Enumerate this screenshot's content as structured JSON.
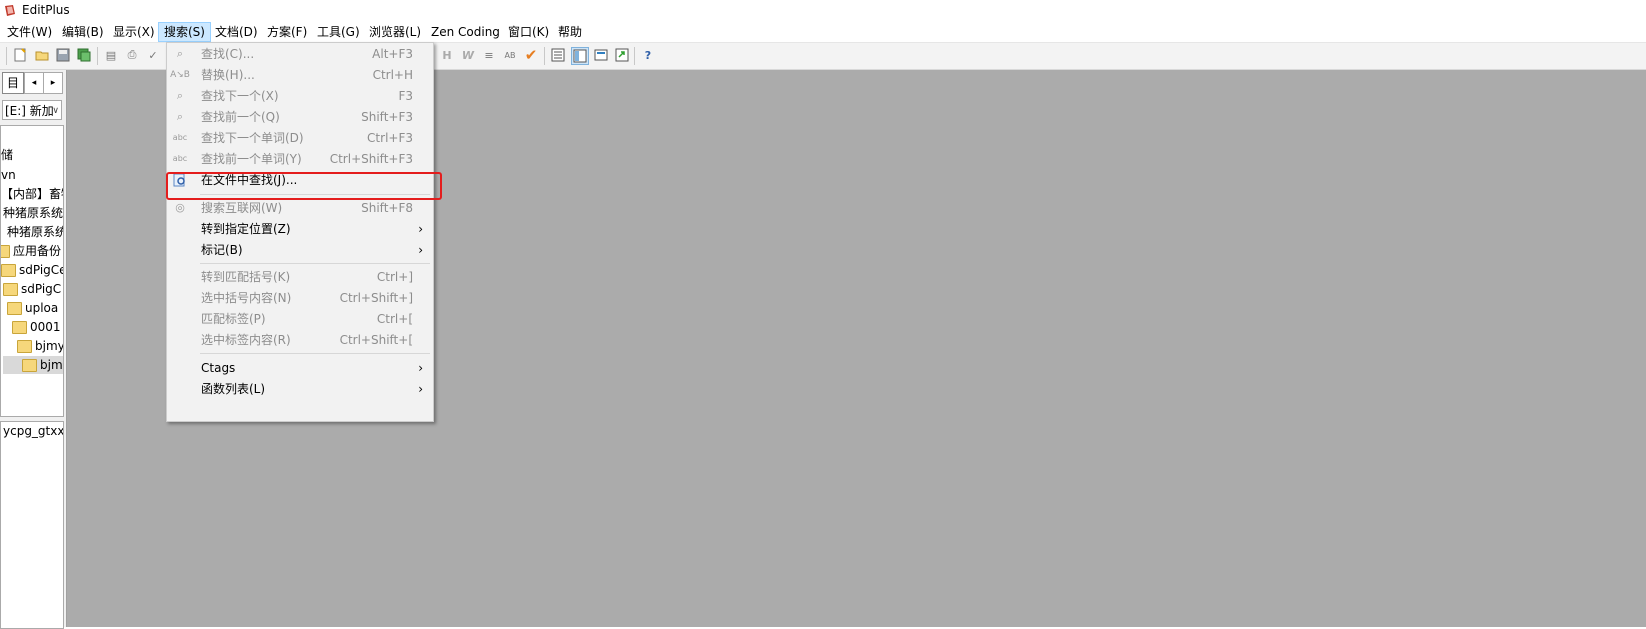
{
  "window": {
    "title": "EditPlus"
  },
  "menubar": [
    {
      "label": "文件(W)"
    },
    {
      "label": "编辑(B)"
    },
    {
      "label": "显示(X)"
    },
    {
      "label": "搜索(S)",
      "active": true
    },
    {
      "label": "文档(D)"
    },
    {
      "label": "方案(F)"
    },
    {
      "label": "工具(G)"
    },
    {
      "label": "浏览器(L)"
    },
    {
      "label": "Zen Coding"
    },
    {
      "label": "窗口(K)"
    },
    {
      "label": "帮助"
    }
  ],
  "left_panel": {
    "tab_label": "目",
    "drive": "[E:] 新加",
    "tree": [
      {
        "label": "储",
        "folder": false
      },
      {
        "label": "vn",
        "folder": false
      },
      {
        "label": "【内部】畜牧",
        "folder": false
      },
      {
        "label": "种猪原系统",
        "folder": false
      },
      {
        "label": "种猪原系统",
        "folder": false
      },
      {
        "label": "应用备份",
        "folder": true
      },
      {
        "label": "sdPigCe",
        "folder": true
      },
      {
        "label": "sdPigC",
        "folder": true
      },
      {
        "label": "uploa",
        "folder": true
      },
      {
        "label": "0001",
        "folder": true
      },
      {
        "label": "bjmy",
        "folder": true
      },
      {
        "label": "bjm",
        "folder": true,
        "selected": true
      }
    ],
    "file": "ycpg_gtxx"
  },
  "search_menu": {
    "items": [
      {
        "label": "查找(C)...",
        "shortcut": "Alt+F3",
        "disabled": true,
        "icon": "find-icon"
      },
      {
        "label": "替换(H)...",
        "shortcut": "Ctrl+H",
        "disabled": true,
        "icon": "replace-icon"
      },
      {
        "label": "查找下一个(X)",
        "shortcut": "F3",
        "disabled": true,
        "icon": "find-next-icon"
      },
      {
        "label": "查找前一个(Q)",
        "shortcut": "Shift+F3",
        "disabled": true,
        "icon": "find-prev-icon"
      },
      {
        "label": "查找下一个单词(D)",
        "shortcut": "Ctrl+F3",
        "disabled": true,
        "icon": "find-next-word-icon"
      },
      {
        "label": "查找前一个单词(Y)",
        "shortcut": "Ctrl+Shift+F3",
        "disabled": true,
        "icon": "find-prev-word-icon"
      },
      {
        "label": "在文件中查找(J)...",
        "shortcut": "",
        "disabled": false,
        "icon": "find-in-files-icon",
        "highlighted": true
      },
      {
        "label": "搜索互联网(W)",
        "shortcut": "Shift+F8",
        "disabled": true,
        "icon": "search-web-icon"
      },
      {
        "label": "转到指定位置(Z)",
        "shortcut": "",
        "disabled": false,
        "submenu": true
      },
      {
        "label": "标记(B)",
        "shortcut": "",
        "disabled": false,
        "submenu": true
      },
      {
        "label": "转到匹配括号(K)",
        "shortcut": "Ctrl+]",
        "disabled": true
      },
      {
        "label": "选中括号内容(N)",
        "shortcut": "Ctrl+Shift+]",
        "disabled": true
      },
      {
        "label": "匹配标签(P)",
        "shortcut": "Ctrl+[",
        "disabled": true
      },
      {
        "label": "选中标签内容(R)",
        "shortcut": "Ctrl+Shift+[",
        "disabled": true
      },
      {
        "label": "Ctags",
        "shortcut": "",
        "disabled": false,
        "submenu": true
      },
      {
        "label": "函数列表(L)",
        "shortcut": "",
        "disabled": false,
        "submenu": true
      }
    ],
    "submenu_arrow": "›"
  },
  "colors": {
    "highlight_border": "#e41d1d",
    "workspace": "#ababab",
    "menu_active": "#cce8ff"
  }
}
